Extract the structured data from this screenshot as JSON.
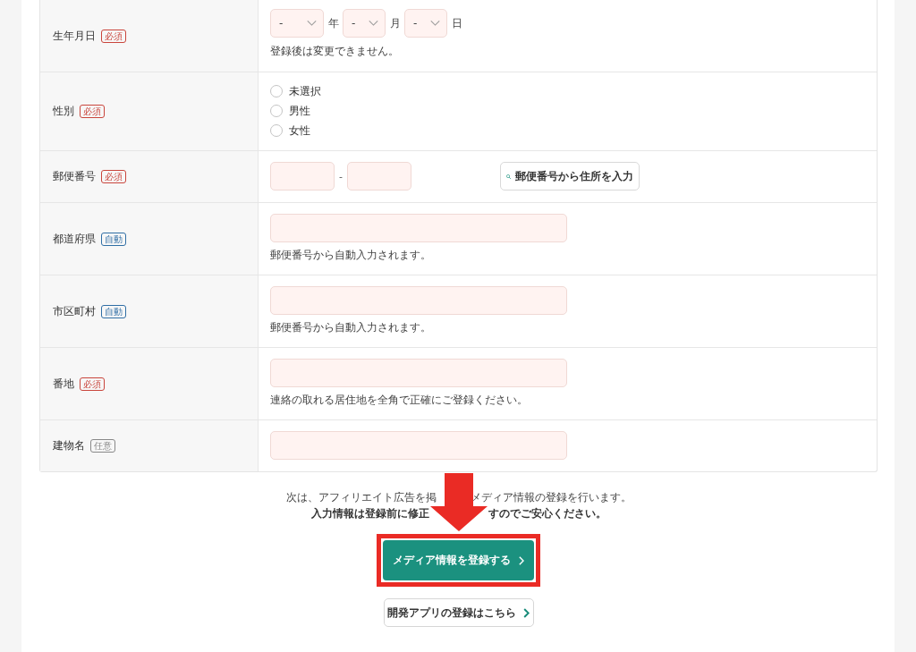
{
  "form": {
    "rows": [
      {
        "label": "生年月日",
        "badge": {
          "text": "必須",
          "color": "#c9453c"
        },
        "field": {
          "kind": "date",
          "selects": [
            {
              "value": "-",
              "unit": "年"
            },
            {
              "value": "-",
              "unit": "月"
            },
            {
              "value": "-",
              "unit": "日"
            }
          ],
          "help": "登録後は変更できません。"
        }
      },
      {
        "label": "性別",
        "badge": {
          "text": "必須",
          "color": "#c9453c"
        },
        "field": {
          "kind": "radio",
          "options": [
            {
              "label": "未選択",
              "selected": false
            },
            {
              "label": "男性",
              "selected": false
            },
            {
              "label": "女性",
              "selected": false
            }
          ]
        }
      },
      {
        "label": "郵便番号",
        "badge": {
          "text": "必須",
          "color": "#c9453c"
        },
        "field": {
          "kind": "postal",
          "separator": "-",
          "button": "郵便番号から住所を入力"
        }
      },
      {
        "label": "都道府県",
        "badge": {
          "text": "自動",
          "color": "#2f6ea5"
        },
        "field": {
          "kind": "text",
          "help": "郵便番号から自動入力されます。"
        }
      },
      {
        "label": "市区町村",
        "badge": {
          "text": "自動",
          "color": "#2f6ea5"
        },
        "field": {
          "kind": "text",
          "help": "郵便番号から自動入力されます。"
        }
      },
      {
        "label": "番地",
        "badge": {
          "text": "必須",
          "color": "#c9453c"
        },
        "field": {
          "kind": "text",
          "help": "連絡の取れる居住地を全角で正確にご登録ください。"
        }
      },
      {
        "label": "建物名",
        "badge": {
          "text": "任意",
          "color": "#888888"
        },
        "field": {
          "kind": "text"
        }
      }
    ]
  },
  "notice": {
    "lines": [
      {
        "kind": "plain",
        "parts": [
          "次は、アフィリエイト広告を掲",
          "メディア情報の登録を行います。"
        ]
      },
      {
        "kind": "strong",
        "parts": [
          "入力情報は登録前に修正",
          "すのでご安心ください。"
        ]
      }
    ]
  },
  "primary_button": {
    "label": "メディア情報を登録する"
  },
  "secondary_button": {
    "label": "開発アプリの登録はこちら"
  }
}
